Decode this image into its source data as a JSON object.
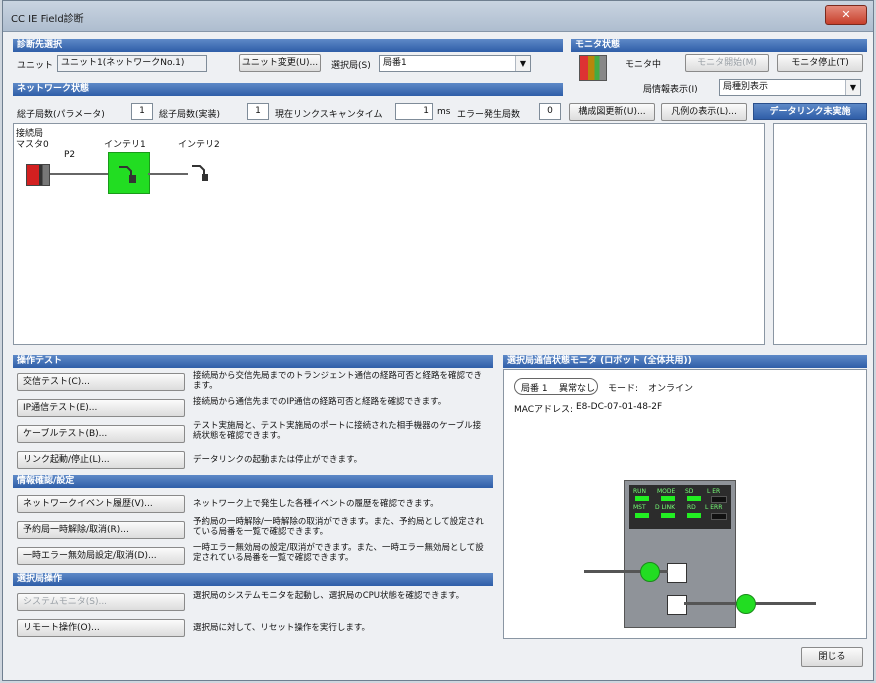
{
  "window": {
    "title": "CC IE Field診断",
    "close_label": "✕"
  },
  "target": {
    "header": "診断先選択",
    "unit_label": "ユニット",
    "unit_value": "ユニット1(ネットワークNo.1)",
    "unit_change_button": "ユニット変更(U)...",
    "station_label": "選択局(S)",
    "station_value": "局番1"
  },
  "monitor": {
    "header": "モニタ状態",
    "status_text": "モニタ中",
    "start_button": "モニタ開始(M)",
    "stop_button": "モニタ停止(T)",
    "station_info_label": "局情報表示(I)",
    "station_info_value": "局種別表示"
  },
  "network": {
    "header": "ネットワーク状態",
    "stations_param_label": "総子局数(パラメータ)",
    "stations_param_value": "1",
    "stations_actual_label": "総子局数(実装)",
    "stations_actual_value": "1",
    "scan_time_label": "現在リンクスキャンタイム",
    "scan_time_value": "1",
    "scan_time_unit": "ms",
    "error_label": "エラー発生局数",
    "error_value": "0",
    "update_button": "構成図更新(U)...",
    "legend_button": "凡例の表示(L)...",
    "data_link_tab": "データリンク未実施",
    "map": {
      "title_line1": "接続局",
      "master_label": "マスタ0",
      "port_label": "P2",
      "node1_label": "インテリ1",
      "node2_label": "インテリ2"
    }
  },
  "op_test": {
    "header": "操作テスト",
    "items": [
      {
        "label": "交信テスト(C)...",
        "desc": "接続局から交信先局までのトランジェント通信の経路可否と経路を確認できます。"
      },
      {
        "label": "IP通信テスト(E)...",
        "desc": "接続局から通信先までのIP通信の経路可否と経路を確認できます。"
      },
      {
        "label": "ケーブルテスト(B)...",
        "desc": "テスト実施局と、テスト実施局のポートに接続された相手機器のケーブル接続状態を確認できます。"
      },
      {
        "label": "リンク起動/停止(L)...",
        "desc": "データリンクの起動または停止ができます。"
      }
    ]
  },
  "info": {
    "header": "情報確認/設定",
    "items": [
      {
        "label": "ネットワークイベント履歴(V)...",
        "desc": "ネットワーク上で発生した各種イベントの履歴を確認できます。"
      },
      {
        "label": "予約局一時解除/取消(R)...",
        "desc": "予約局の一時解除/一時解除の取消ができます。また、予約局として設定されている局番を一覧で確認できます。"
      },
      {
        "label": "一時エラー無効局設定/取消(D)...",
        "desc": "一時エラー無効局の設定/取消ができます。また、一時エラー無効局として設定されている局番を一覧で確認できます。"
      }
    ]
  },
  "selected_op": {
    "header": "選択局操作",
    "items": [
      {
        "label": "システムモニタ(S)...",
        "desc": "選択局のシステムモニタを起動し、選択局のCPU状態を確認できます。"
      },
      {
        "label": "リモート操作(O)...",
        "desc": "選択局に対して、リセット操作を実行します。"
      }
    ]
  },
  "station_monitor": {
    "header": "選択局通信状態モニタ (ロボット (全体共用))",
    "station_badge": "局番 1",
    "status_badge": "異常なし",
    "mode_label": "モード:",
    "mode_value": "オンライン",
    "mac_label": "MACアドレス:",
    "mac_value": "E8-DC-07-01-48-2F",
    "leds_row1": [
      "RUN",
      "MODE",
      "SD",
      "L ER"
    ],
    "leds_row2": [
      "MST",
      "D LINK",
      "RD",
      "L ERR"
    ]
  },
  "footer": {
    "close_button": "閉じる"
  }
}
